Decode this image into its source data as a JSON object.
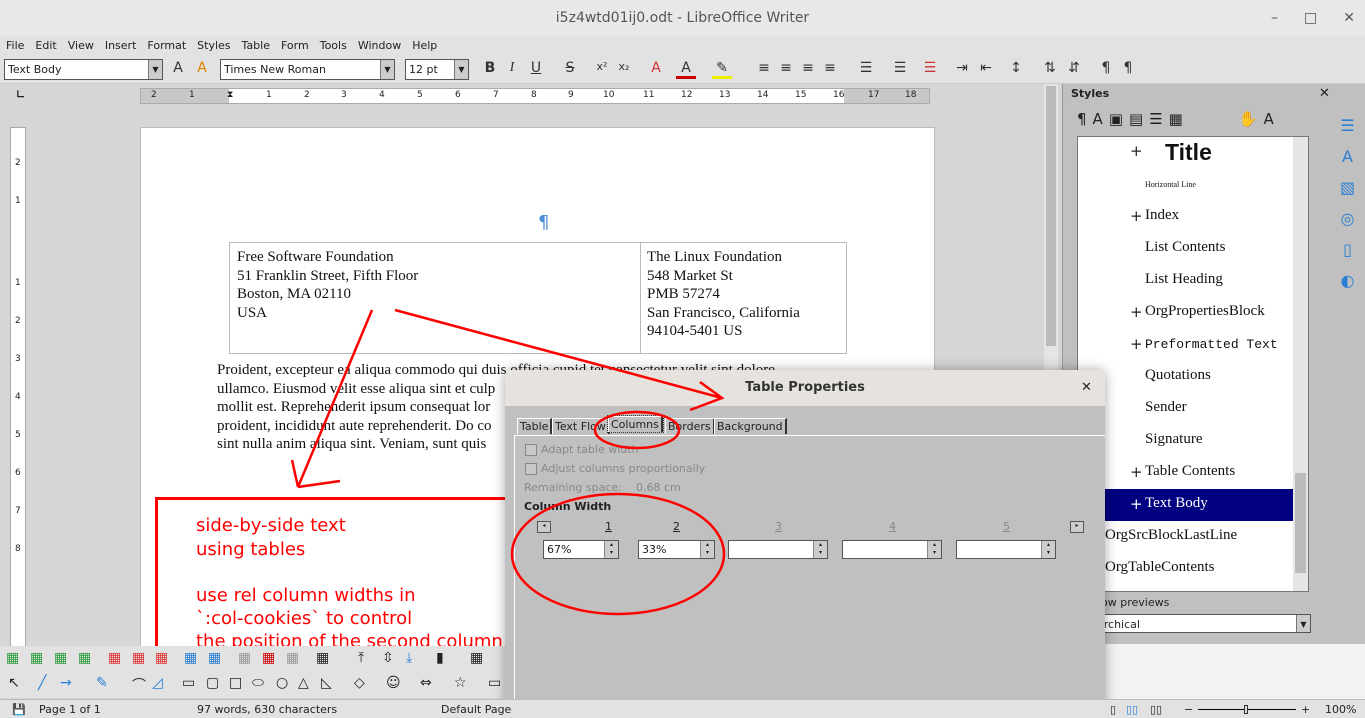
{
  "window": {
    "title": "i5z4wtd01ij0.odt - LibreOffice Writer",
    "minimize": "–",
    "maximize": "□",
    "close": "✕"
  },
  "menu": [
    "File",
    "Edit",
    "View",
    "Insert",
    "Format",
    "Styles",
    "Table",
    "Form",
    "Tools",
    "Window",
    "Help"
  ],
  "toolbar": {
    "paragraph_style": "Text Body",
    "font_name": "Times New Roman",
    "font_size": "12 pt",
    "bold": "B",
    "italic": "I",
    "underline": "U",
    "strike": "S"
  },
  "ruler": {
    "labels": [
      "2",
      "1",
      "1",
      "2",
      "3",
      "4",
      "5",
      "6",
      "7",
      "8",
      "9",
      "10",
      "11",
      "12",
      "13",
      "14",
      "15",
      "16",
      "17",
      "18"
    ]
  },
  "vruler": {
    "labels": [
      "2",
      "1",
      "1",
      "2",
      "3",
      "4",
      "5",
      "6",
      "7",
      "8"
    ]
  },
  "document": {
    "pilcrow": "¶",
    "table": {
      "col1": [
        "Free Software Foundation",
        "51 Franklin Street, Fifth Floor",
        "Boston, MA 02110",
        "USA"
      ],
      "col2": [
        "The Linux Foundation",
        "548 Market St",
        "PMB 57274",
        "San Francisco, California",
        "94104-5401 US"
      ]
    },
    "body_lines": [
      "Proident, excepteur ea aliqua commodo qui duis officia cupid tet consectetur velit sint dolore",
      "ullamco. Eiusmod velit esse aliqua sint et culp",
      "mollit est. Reprehenderit ipsum consequat lor",
      "proident, incididunt aute reprehenderit. Do co",
      "sint nulla anim aliqua sint. Veniam, sunt quis"
    ]
  },
  "annotation": {
    "lines": [
      "side-by-side text",
      "using tables",
      "",
      "use rel column widths in",
      "`:col-cookies` to control",
      "the position of the second column"
    ],
    "color": "#ff0000"
  },
  "dialog": {
    "title": "Table Properties",
    "close": "✕",
    "tabs": [
      "Table",
      "Text Flow",
      "Columns",
      "Borders",
      "Background"
    ],
    "active_tab": "Columns",
    "adapt_table_width": {
      "label": "Adapt table width",
      "checked": false
    },
    "adjust_proportionally": {
      "label": "Adjust columns proportionally",
      "checked": false
    },
    "remaining_label": "Remaining space:",
    "remaining_value": "0.68 cm",
    "column_width_heading": "Column Width",
    "columns": [
      {
        "num": "1",
        "value": "67%"
      },
      {
        "num": "2",
        "value": "33%"
      },
      {
        "num": "3",
        "value": ""
      },
      {
        "num": "4",
        "value": ""
      },
      {
        "num": "5",
        "value": ""
      }
    ]
  },
  "styles_panel": {
    "title": "Styles",
    "close": "✕",
    "items": [
      {
        "label": "Title",
        "plus": true
      },
      {
        "label": "Horizontal Line",
        "plus": false
      },
      {
        "label": "Index",
        "plus": true
      },
      {
        "label": "List Contents",
        "plus": false
      },
      {
        "label": "List Heading",
        "plus": false
      },
      {
        "label": "OrgPropertiesBlock",
        "plus": true
      },
      {
        "label": "Preformatted Text",
        "plus": true
      },
      {
        "label": "Quotations",
        "plus": false
      },
      {
        "label": "Sender",
        "plus": false
      },
      {
        "label": "Signature",
        "plus": false
      },
      {
        "label": "Table Contents",
        "plus": true
      },
      {
        "label": "Text Body",
        "plus": true,
        "selected": true
      },
      {
        "label": "OrgSrcBlockLastLine",
        "plus": false
      },
      {
        "label": "OrgTableContents",
        "plus": false
      }
    ],
    "show_previews": "ow previews",
    "filter": "archical"
  },
  "statusbar": {
    "page": "Page 1 of 1",
    "words": "97 words, 630 characters",
    "page_style": "Default Page",
    "zoom": "100%"
  },
  "colors": {
    "selection": "#000080",
    "accent": "#4a90d9"
  }
}
